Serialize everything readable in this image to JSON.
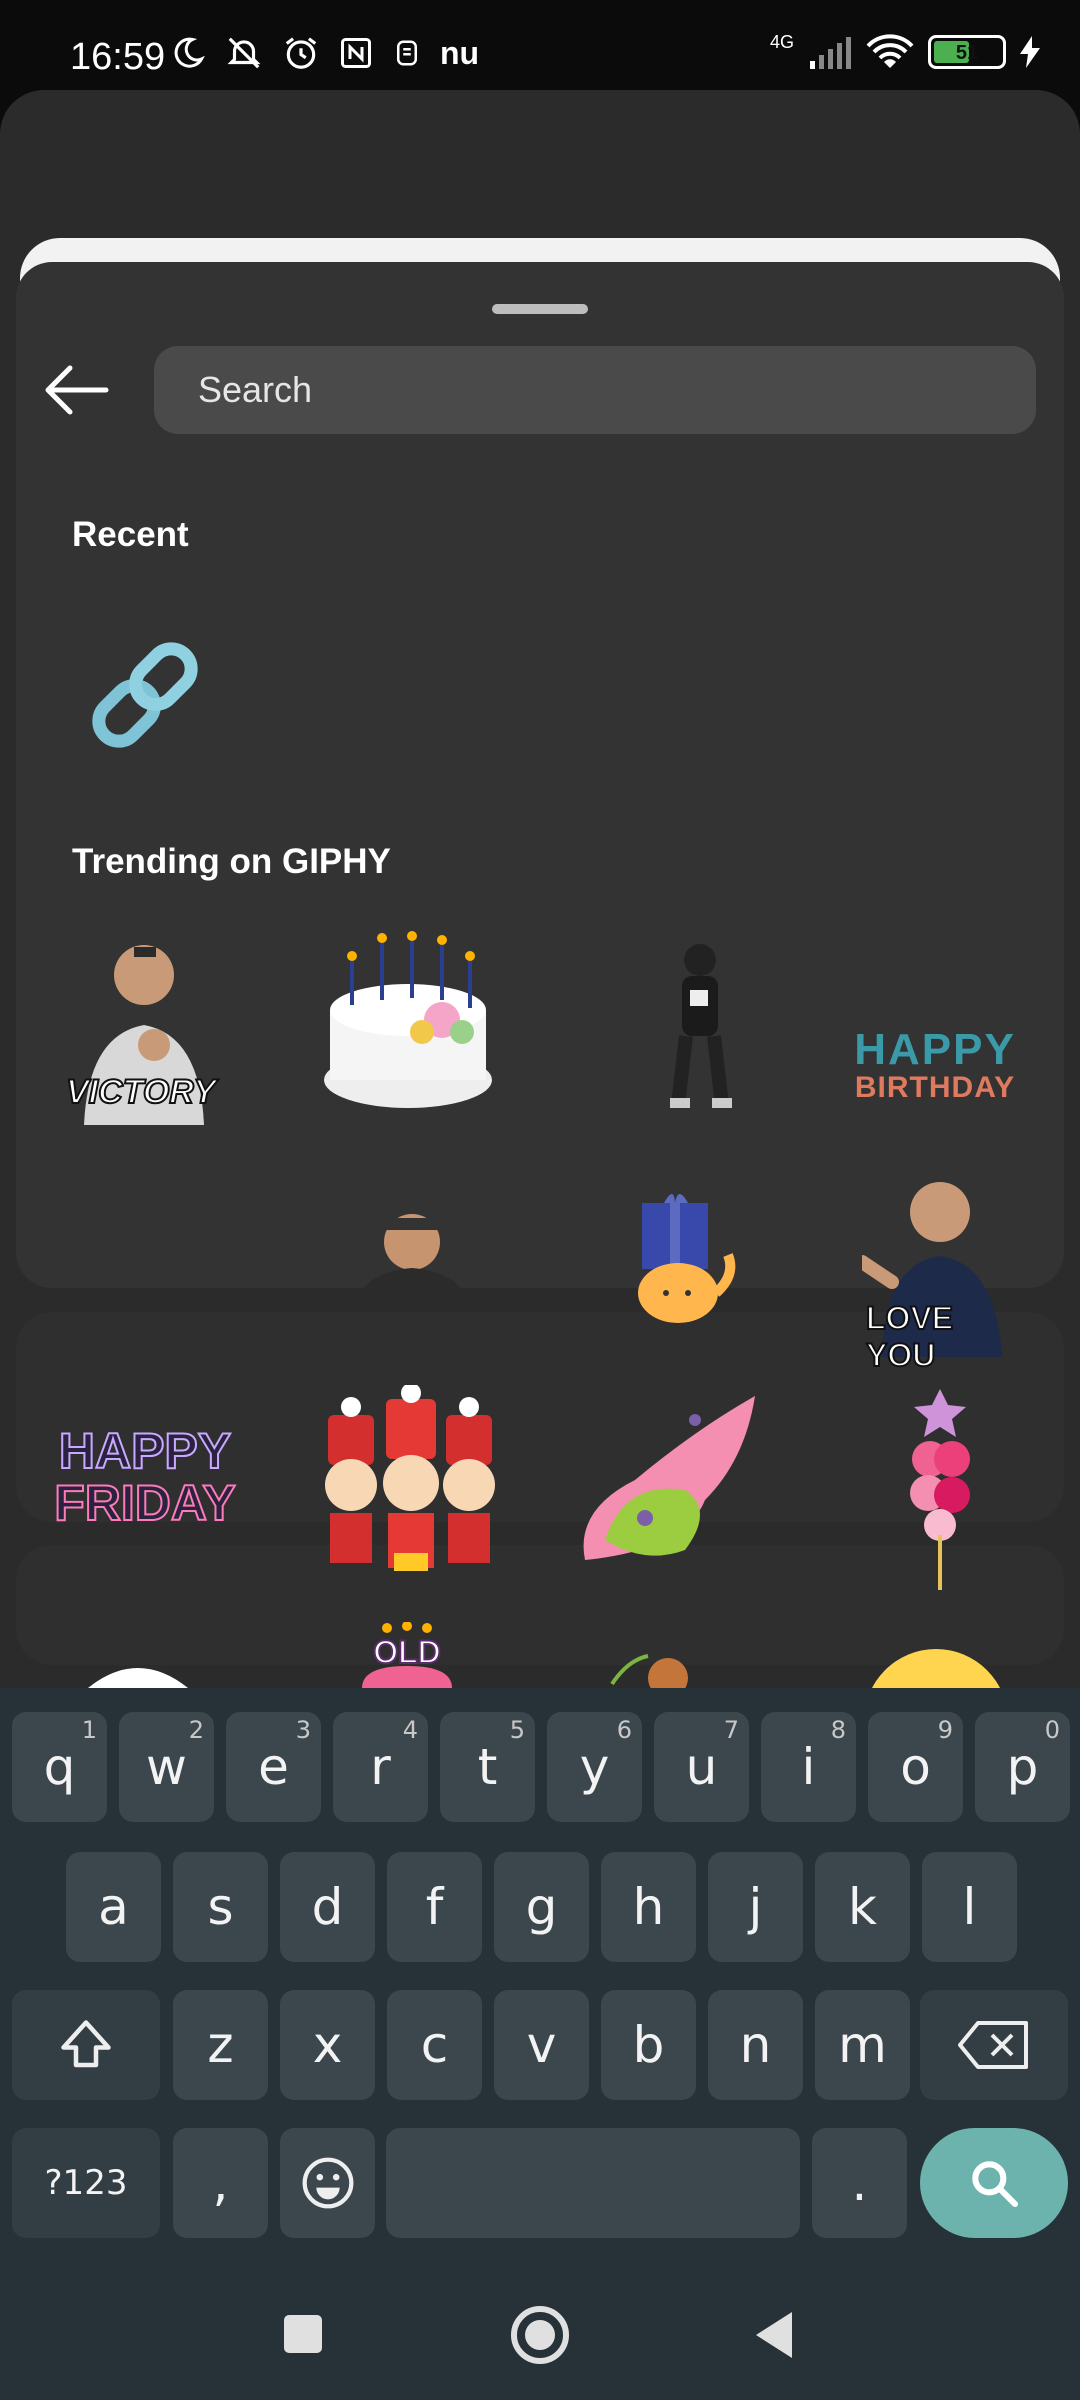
{
  "status_bar": {
    "time": "16:59",
    "network": "4G",
    "battery": "51",
    "battery_level": 0.51,
    "left_icons": [
      "moon-icon",
      "bell-off-icon",
      "alarm-icon",
      "nfc-icon",
      "app-icon",
      "nu-icon"
    ],
    "right_icons": [
      "signal-icon",
      "wifi-icon",
      "battery-icon",
      "charging-icon"
    ],
    "nu_label": "nu"
  },
  "sheet": {
    "search_placeholder": "Search",
    "recent_title": "Recent",
    "trending_title": "Trending on GIPHY"
  },
  "stickers": {
    "victory": "VICTORY",
    "happy_birthday_1": "HAPPY",
    "happy_birthday_2": "BIRTHDAY",
    "love_you": "LOVE YOU",
    "happy_friday_1": "HAPPY",
    "happy_friday_2": "FRIDAY",
    "old": "OLD"
  },
  "keyboard": {
    "row1": [
      {
        "k": "q",
        "h": "1"
      },
      {
        "k": "w",
        "h": "2"
      },
      {
        "k": "e",
        "h": "3"
      },
      {
        "k": "r",
        "h": "4"
      },
      {
        "k": "t",
        "h": "5"
      },
      {
        "k": "y",
        "h": "6"
      },
      {
        "k": "u",
        "h": "7"
      },
      {
        "k": "i",
        "h": "8"
      },
      {
        "k": "o",
        "h": "9"
      },
      {
        "k": "p",
        "h": "0"
      }
    ],
    "row2": [
      "a",
      "s",
      "d",
      "f",
      "g",
      "h",
      "j",
      "k",
      "l"
    ],
    "row3": [
      "z",
      "x",
      "c",
      "v",
      "b",
      "n",
      "m"
    ],
    "symbols": "?123",
    "comma": ",",
    "period": "."
  },
  "colors": {
    "sheet": "#333333",
    "keyboard": "#263238",
    "key": "#3c474d",
    "search_key": "#6db3ad",
    "link_icon": "#7ec4d6"
  }
}
